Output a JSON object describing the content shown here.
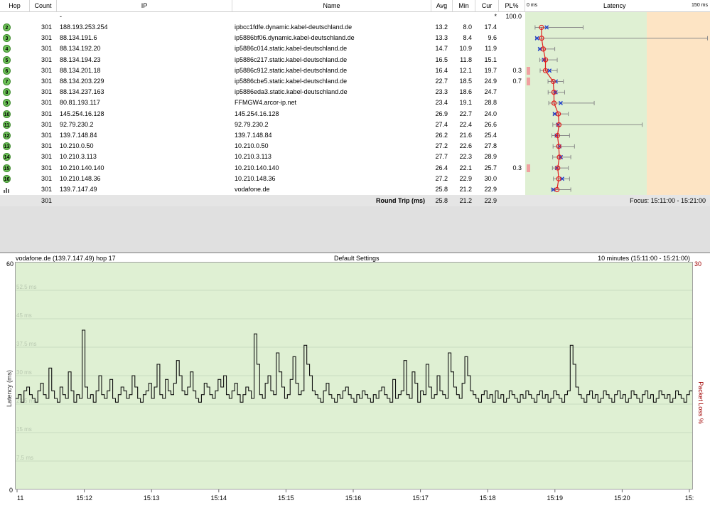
{
  "columns": {
    "hop": "Hop",
    "count": "Count",
    "ip": "IP",
    "name": "Name",
    "avg": "Avg",
    "min": "Min",
    "cur": "Cur",
    "pl": "PL%",
    "lat_start": "0 ms",
    "latency": "Latency",
    "lat_end": "150 ms"
  },
  "first_row": {
    "ip": "-",
    "cur": "*",
    "pl": "100.0"
  },
  "hops": [
    {
      "hop": "2",
      "count": "301",
      "ip": "188.193.253.254",
      "name": "ipbcc1fdfe.dynamic.kabel-deutschland.de",
      "avg": "13.2",
      "min": "8.0",
      "cur": "17.4",
      "pl": "",
      "avg_v": 13.2,
      "min_v": 8.0,
      "max_v": 47,
      "cur_v": 17.4
    },
    {
      "hop": "3",
      "count": "301",
      "ip": "88.134.191.6",
      "name": "ip5886bf06.dynamic.kabel-deutschland.de",
      "avg": "13.3",
      "min": "8.4",
      "cur": "9.6",
      "pl": "",
      "avg_v": 13.3,
      "min_v": 8.4,
      "max_v": 148,
      "cur_v": 9.6
    },
    {
      "hop": "4",
      "count": "301",
      "ip": "88.134.192.20",
      "name": "ip5886c014.static.kabel-deutschland.de",
      "avg": "14.7",
      "min": "10.9",
      "cur": "11.9",
      "pl": "",
      "avg_v": 14.7,
      "min_v": 10.9,
      "max_v": 24,
      "cur_v": 11.9
    },
    {
      "hop": "5",
      "count": "301",
      "ip": "88.134.194.23",
      "name": "ip5886c217.static.kabel-deutschland.de",
      "avg": "16.5",
      "min": "11.8",
      "cur": "15.1",
      "pl": "",
      "avg_v": 16.5,
      "min_v": 11.8,
      "max_v": 26,
      "cur_v": 15.1
    },
    {
      "hop": "6",
      "count": "301",
      "ip": "88.134.201.18",
      "name": "ip5886c912.static.kabel-deutschland.de",
      "avg": "16.4",
      "min": "12.1",
      "cur": "19.7",
      "pl": "0.3",
      "avg_v": 16.4,
      "min_v": 12.1,
      "max_v": 26,
      "cur_v": 19.7
    },
    {
      "hop": "7",
      "count": "301",
      "ip": "88.134.203.229",
      "name": "ip5886cbe5.static.kabel-deutschland.de",
      "avg": "22.7",
      "min": "18.5",
      "cur": "24.9",
      "pl": "0.7",
      "avg_v": 22.7,
      "min_v": 18.5,
      "max_v": 31,
      "cur_v": 24.9
    },
    {
      "hop": "8",
      "count": "301",
      "ip": "88.134.237.163",
      "name": "ip5886eda3.static.kabel-deutschland.de",
      "avg": "23.3",
      "min": "18.6",
      "cur": "24.7",
      "pl": "",
      "avg_v": 23.3,
      "min_v": 18.6,
      "max_v": 32,
      "cur_v": 24.7
    },
    {
      "hop": "9",
      "count": "301",
      "ip": "80.81.193.117",
      "name": "FFMGW4.arcor-ip.net",
      "avg": "23.4",
      "min": "19.1",
      "cur": "28.8",
      "pl": "",
      "avg_v": 23.4,
      "min_v": 19.1,
      "max_v": 56,
      "cur_v": 28.8
    },
    {
      "hop": "10",
      "count": "301",
      "ip": "145.254.16.128",
      "name": "145.254.16.128",
      "avg": "26.9",
      "min": "22.7",
      "cur": "24.0",
      "pl": "",
      "avg_v": 26.9,
      "min_v": 22.7,
      "max_v": 35,
      "cur_v": 24.0
    },
    {
      "hop": "11",
      "count": "301",
      "ip": "92.79.230.2",
      "name": "92.79.230.2",
      "avg": "27.4",
      "min": "22.4",
      "cur": "26.6",
      "pl": "",
      "avg_v": 27.4,
      "min_v": 22.4,
      "max_v": 95,
      "cur_v": 26.6
    },
    {
      "hop": "12",
      "count": "301",
      "ip": "139.7.148.84",
      "name": "139.7.148.84",
      "avg": "26.2",
      "min": "21.6",
      "cur": "25.4",
      "pl": "",
      "avg_v": 26.2,
      "min_v": 21.6,
      "max_v": 36,
      "cur_v": 25.4
    },
    {
      "hop": "13",
      "count": "301",
      "ip": "10.210.0.50",
      "name": "10.210.0.50",
      "avg": "27.2",
      "min": "22.6",
      "cur": "27.8",
      "pl": "",
      "avg_v": 27.2,
      "min_v": 22.6,
      "max_v": 40,
      "cur_v": 27.8
    },
    {
      "hop": "14",
      "count": "301",
      "ip": "10.210.3.113",
      "name": "10.210.3.113",
      "avg": "27.7",
      "min": "22.3",
      "cur": "28.9",
      "pl": "",
      "avg_v": 27.7,
      "min_v": 22.3,
      "max_v": 37,
      "cur_v": 28.9
    },
    {
      "hop": "15",
      "count": "301",
      "ip": "10.210.140.140",
      "name": "10.210.140.140",
      "avg": "26.4",
      "min": "22.1",
      "cur": "25.7",
      "pl": "0.3",
      "avg_v": 26.4,
      "min_v": 22.1,
      "max_v": 35,
      "cur_v": 25.7
    },
    {
      "hop": "16",
      "count": "301",
      "ip": "10.210.148.36",
      "name": "10.210.148.36",
      "avg": "27.2",
      "min": "22.9",
      "cur": "30.0",
      "pl": "",
      "avg_v": 27.2,
      "min_v": 22.9,
      "max_v": 36,
      "cur_v": 30.0
    },
    {
      "hop": "17",
      "count": "301",
      "ip": "139.7.147.49",
      "name": "vodafone.de",
      "avg": "25.8",
      "min": "21.2",
      "cur": "22.9",
      "pl": "",
      "avg_v": 25.8,
      "min_v": 21.2,
      "max_v": 37,
      "cur_v": 22.9
    }
  ],
  "summary": {
    "count": "301",
    "label": "Round Trip (ms)",
    "avg": "25.8",
    "min": "21.2",
    "cur": "22.9",
    "focus": "Focus: 15:11:00 - 15:21:00"
  },
  "graph": {
    "target": "vodafone.de (139.7.147.49) hop 17",
    "settings": "Default Settings",
    "range": "10 minutes (15:11:00 - 15:21:00)",
    "y_axis_label": "Latency (ms)",
    "right_axis_label": "Packet Loss %",
    "y_top": "60",
    "y_zero": "0",
    "right_top": "30",
    "y_gridlabels": [
      "52.5 ms",
      "45 ms",
      "37.5 ms",
      "30 ms",
      "22.5 ms",
      "15 ms",
      "7.5 ms"
    ],
    "x_ticks": [
      "11",
      "15:12",
      "15:13",
      "15:14",
      "15:15",
      "15:16",
      "15:17",
      "15:18",
      "15:19",
      "15:20",
      "15:"
    ]
  },
  "chart_data": {
    "type": "line",
    "title": "Default Settings",
    "xlabel": "",
    "ylabel": "Latency (ms)",
    "ylim": [
      0,
      60
    ],
    "x_range": [
      "15:11:00",
      "15:21:00"
    ],
    "series": [
      {
        "name": "vodafone.de (139.7.147.49) hop 17",
        "values": [
          24,
          25,
          23,
          26,
          27,
          25,
          24,
          23,
          26,
          28,
          25,
          24,
          32,
          26,
          24,
          23,
          27,
          25,
          24,
          31,
          26,
          23,
          25,
          24,
          42,
          27,
          24,
          25,
          23,
          26,
          30,
          25,
          24,
          26,
          29,
          24,
          23,
          25,
          27,
          26,
          24,
          25,
          30,
          27,
          24,
          23,
          25,
          26,
          28,
          24,
          27,
          33,
          25,
          24,
          29,
          26,
          25,
          28,
          34,
          30,
          26,
          25,
          27,
          31,
          26,
          24,
          23,
          25,
          28,
          27,
          25,
          24,
          26,
          29,
          27,
          30,
          25,
          24,
          26,
          28,
          25,
          23,
          25,
          27,
          26,
          24,
          41,
          33,
          25,
          24,
          28,
          30,
          26,
          25,
          36,
          31,
          27,
          24,
          25,
          29,
          35,
          28,
          25,
          26,
          38,
          33,
          30,
          26,
          25,
          24,
          23,
          26,
          28,
          25,
          24,
          23,
          25,
          24,
          26,
          27,
          25,
          24,
          23,
          25,
          24,
          26,
          25,
          24,
          23,
          25,
          24,
          26,
          27,
          25,
          24,
          23,
          29,
          24,
          25,
          26,
          34,
          25,
          24,
          31,
          28,
          23,
          26,
          25,
          33,
          27,
          24,
          25,
          30,
          26,
          25,
          24,
          36,
          31,
          27,
          25,
          24,
          28,
          35,
          30,
          26,
          25,
          24,
          23,
          25,
          26,
          24,
          25,
          23,
          26,
          24,
          25,
          23,
          24,
          26,
          25,
          24,
          23,
          25,
          24,
          26,
          25,
          24,
          23,
          25,
          26,
          24,
          25,
          23,
          24,
          26,
          25,
          24,
          23,
          25,
          26,
          38,
          33,
          27,
          25,
          24,
          23,
          25,
          26,
          24,
          25,
          23,
          24,
          26,
          25,
          24,
          23,
          25,
          26,
          24,
          25,
          23,
          24,
          26,
          25,
          24,
          23,
          25,
          26,
          24,
          25,
          23,
          24,
          26,
          25,
          24,
          25,
          23,
          24,
          26,
          25,
          24,
          23,
          25,
          26
        ]
      }
    ]
  }
}
